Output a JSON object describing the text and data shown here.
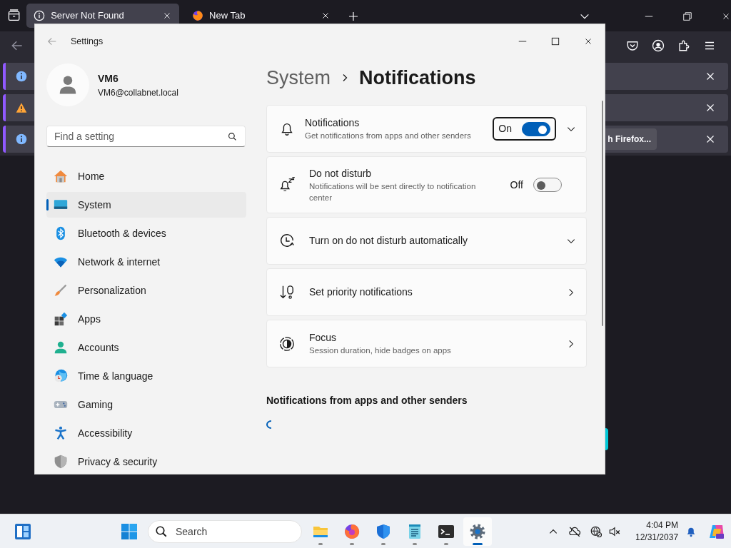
{
  "browser": {
    "tabs": [
      {
        "title": "Server Not Found",
        "selected": true
      },
      {
        "title": "New Tab",
        "selected": false
      }
    ],
    "notification_bars": [
      {
        "kind": "info"
      },
      {
        "kind": "warning"
      },
      {
        "kind": "info",
        "button": "h Firefox..."
      }
    ]
  },
  "settings": {
    "title": "Settings",
    "user": {
      "name": "VM6",
      "email": "VM6@collabnet.local"
    },
    "search": {
      "placeholder": "Find a setting"
    },
    "nav": [
      {
        "label": "Home",
        "selected": false
      },
      {
        "label": "System",
        "selected": true
      },
      {
        "label": "Bluetooth & devices",
        "selected": false
      },
      {
        "label": "Network & internet",
        "selected": false
      },
      {
        "label": "Personalization",
        "selected": false
      },
      {
        "label": "Apps",
        "selected": false
      },
      {
        "label": "Accounts",
        "selected": false
      },
      {
        "label": "Time & language",
        "selected": false
      },
      {
        "label": "Gaming",
        "selected": false
      },
      {
        "label": "Accessibility",
        "selected": false
      },
      {
        "label": "Privacy & security",
        "selected": false
      }
    ],
    "breadcrumb": [
      "System",
      "Notifications"
    ],
    "cards": [
      {
        "kind": "toggle",
        "title": "Notifications",
        "subtitle": "Get notifications from apps and other senders",
        "state": "On",
        "on": true,
        "focused": true,
        "expandable": true
      },
      {
        "kind": "toggle",
        "title": "Do not disturb",
        "subtitle": "Notifications will be sent directly to notification center",
        "state": "Off",
        "on": false,
        "focused": false,
        "expandable": false
      },
      {
        "kind": "expander",
        "title": "Turn on do not disturb automatically"
      },
      {
        "kind": "link",
        "title": "Set priority notifications"
      },
      {
        "kind": "link",
        "title": "Focus",
        "subtitle": "Session duration, hide badges on apps"
      }
    ],
    "section_heading": "Notifications from apps and other senders"
  },
  "taskbar": {
    "search": {
      "placeholder": "Search"
    },
    "apps": [
      {
        "selected": false
      },
      {
        "selected": false
      },
      {
        "selected": false
      },
      {
        "selected": false
      },
      {
        "selected": false
      },
      {
        "selected": true
      }
    ],
    "time": "4:04 PM",
    "date": "12/31/2037"
  }
}
